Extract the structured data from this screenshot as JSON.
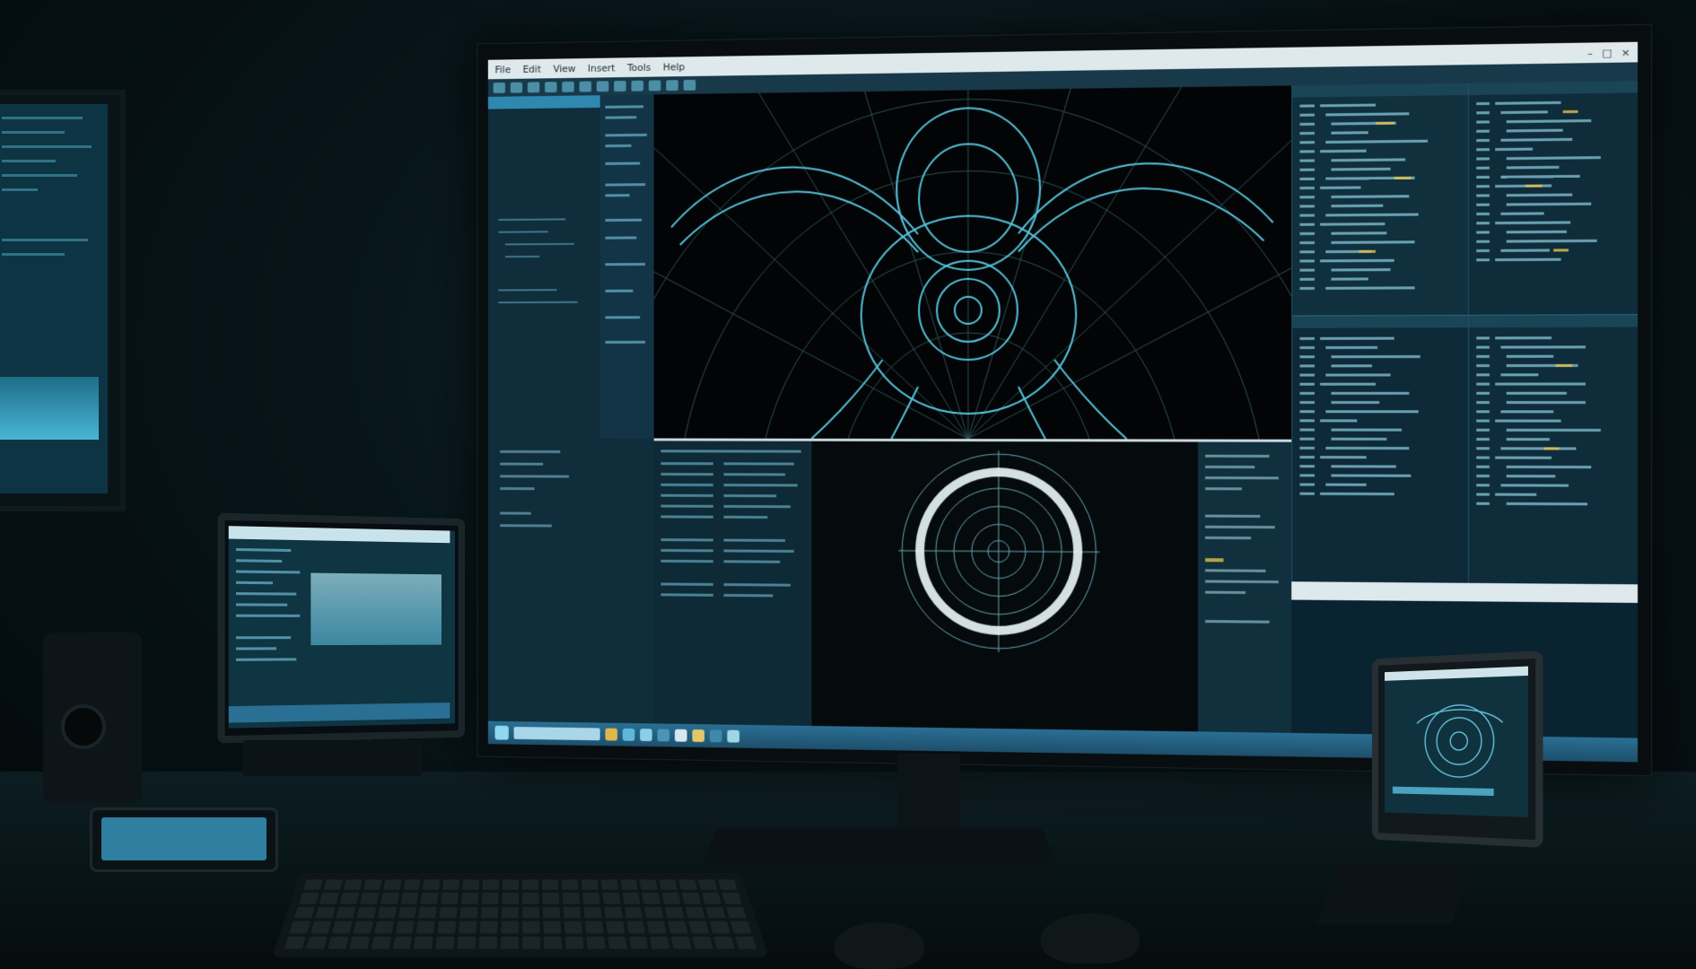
{
  "main_app": {
    "title_bar": {
      "menu_items": [
        "File",
        "Edit",
        "View",
        "Insert",
        "Tools",
        "Help"
      ]
    },
    "toolbar": {
      "label_1": "",
      "label_2": "",
      "label_3": ""
    },
    "left_panel": {
      "header": "",
      "rows": [
        "",
        "",
        "",
        "",
        "",
        "",
        "",
        "",
        ""
      ]
    },
    "viewport": {
      "name": ""
    },
    "status_strip": {
      "text": ""
    }
  },
  "colors": {
    "accent": "#4fc3e0",
    "wireframe": "#5fd6f0",
    "screen_bg": "#0a2330",
    "taskbar": "#2a6f94"
  },
  "icons": {
    "window_controls": [
      "minimize-icon",
      "maximize-icon",
      "close-icon"
    ],
    "taskbar_icons": [
      "folder-icon",
      "browser-icon",
      "mail-icon",
      "settings-icon",
      "terminal-icon",
      "media-icon",
      "chart-icon",
      "grid-icon"
    ]
  }
}
